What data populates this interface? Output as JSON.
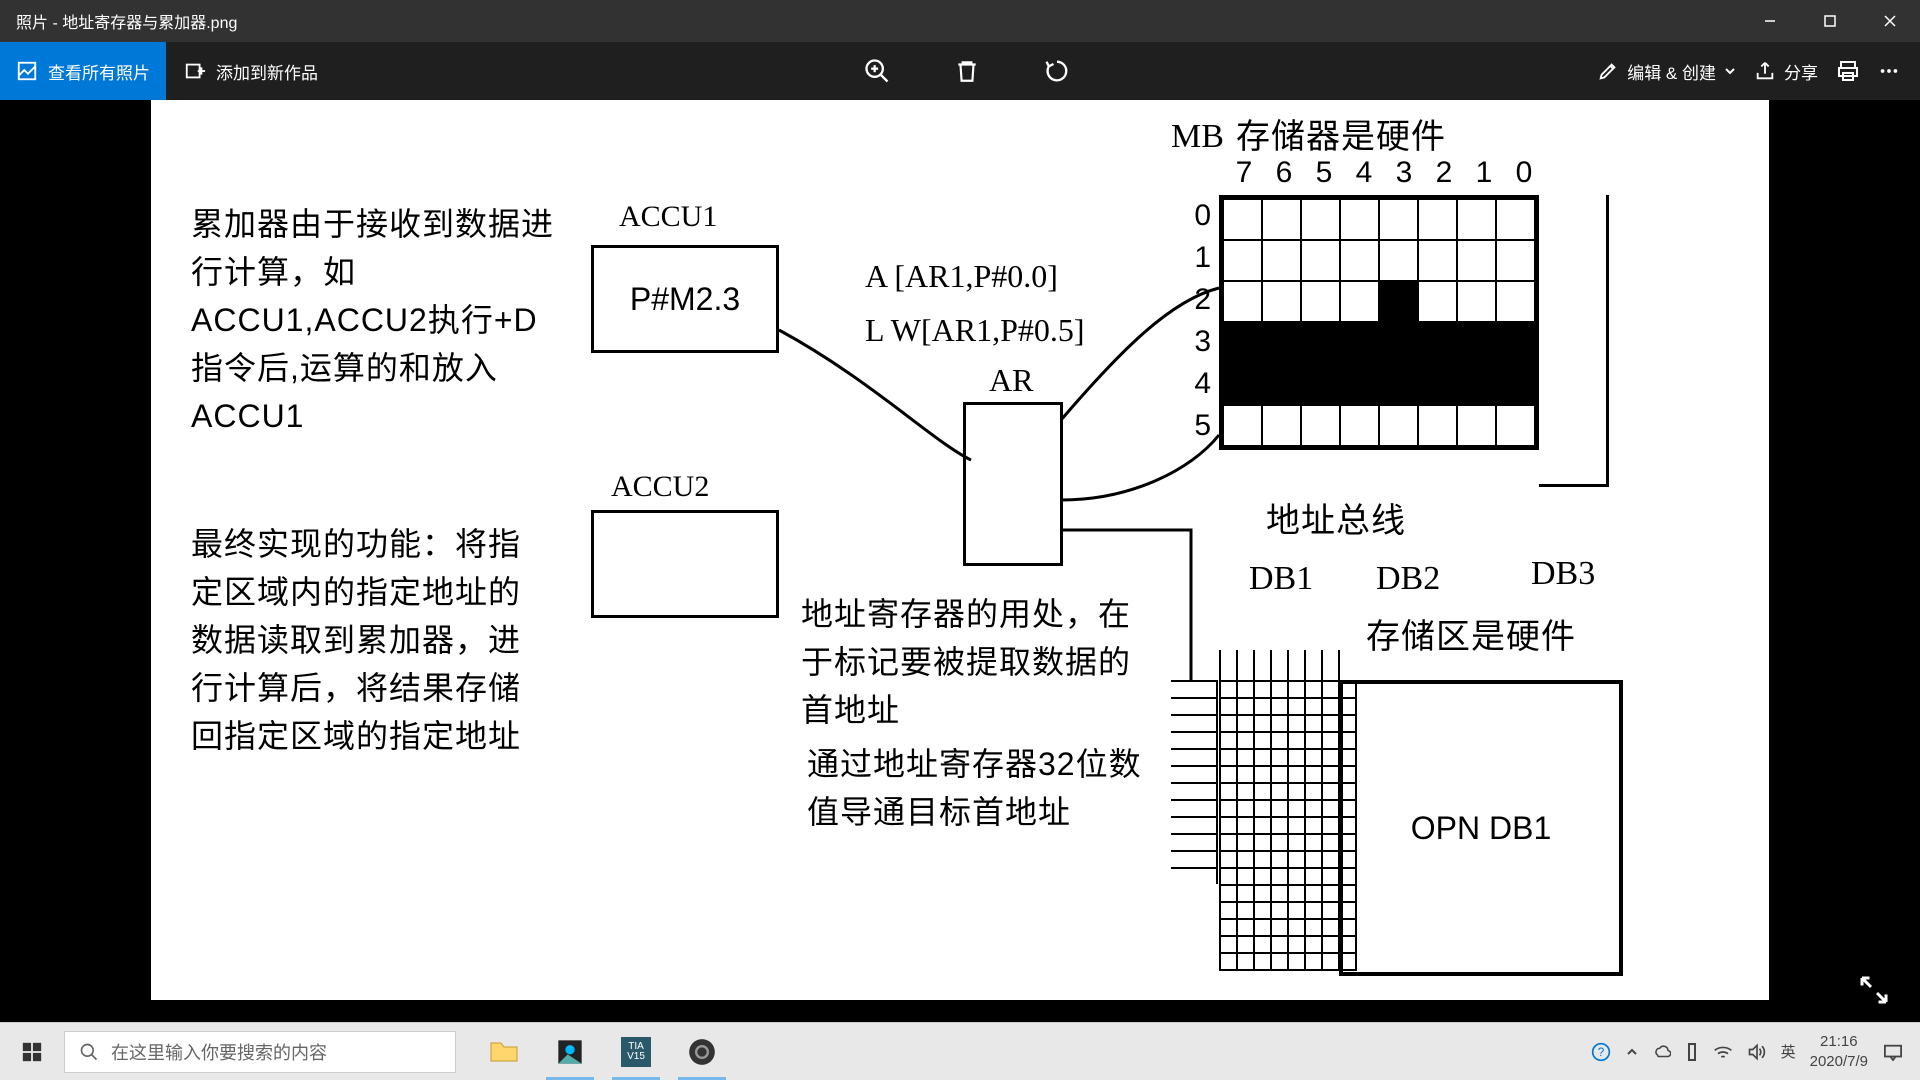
{
  "titlebar": {
    "title": "照片 - 地址寄存器与累加器.png"
  },
  "toolbar": {
    "view_all": "查看所有照片",
    "add_to": "添加到新作品",
    "edit_create": "编辑 & 创建",
    "share": "分享"
  },
  "diagram": {
    "text_accu": "累加器由于接收到数据进行计算，如ACCU1,ACCU2执行+D指令后,运算的和放入ACCU1",
    "text_func": "最终实现的功能：将指定区域内的指定地址的数据读取到累加器，进行计算后，将结果存储回指定区域的指定地址",
    "accu1_label": "ACCU1",
    "accu1_val": "P#M2.3",
    "accu2_label": "ACCU2",
    "code1": "A [AR1,P#0.0]",
    "code2": "L W[AR1,P#0.5]",
    "ar_label": "AR",
    "text_ar1": "地址寄存器的用处，在于标记要被提取数据的首地址",
    "text_ar2": "通过地址寄存器32位数值导通目标首地址",
    "mb_label": "MB",
    "mem_title": "存储器是硬件",
    "addr_bus": "地址总线",
    "db1": "DB1",
    "db2": "DB2",
    "db3": "DB3",
    "store_hw": "存储区是硬件",
    "opn": "OPN DB1",
    "bits": [
      "7",
      "6",
      "5",
      "4",
      "3",
      "2",
      "1",
      "0"
    ],
    "rows": [
      "0",
      "1",
      "2",
      "3",
      "4",
      "5"
    ]
  },
  "taskbar": {
    "search_placeholder": "在这里输入你要搜索的内容",
    "ime": "英",
    "time": "21:16",
    "date": "2020/7/9"
  }
}
